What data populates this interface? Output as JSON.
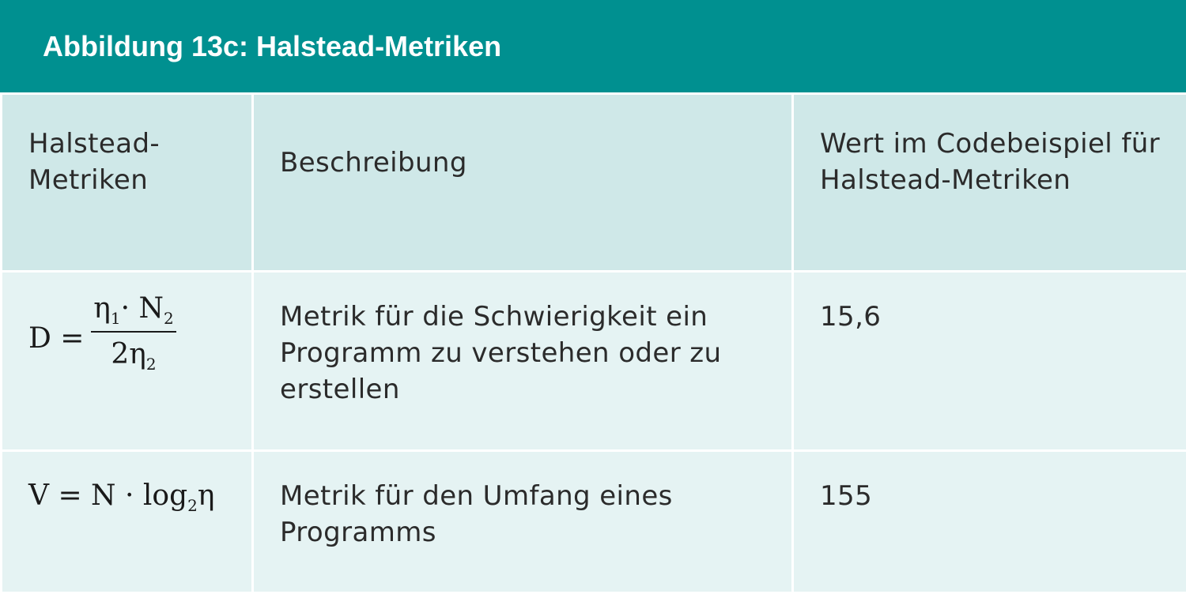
{
  "title": "Abbildung 13c: Halstead-Metriken",
  "colors": {
    "title_bar": "#009090",
    "header_row": "#cfe8e8",
    "body_row": "#e5f3f3"
  },
  "table": {
    "headers": [
      "Halstead-Metriken",
      "Beschreibung",
      "Wert im Codebeispiel für Halstead-Metriken"
    ],
    "rows": [
      {
        "formula": {
          "lhs": "D =",
          "numerator": "η",
          "numerator_sub": "1",
          "numerator_mid": "· N",
          "numerator_sub2": "2",
          "denominator": "2η",
          "denominator_sub": "2"
        },
        "description": "Metrik für die Schwierigkeit ein Programm zu verstehen oder zu erstellen",
        "value": "15,6"
      },
      {
        "formula": {
          "main": "V = N · log",
          "sub": "2",
          "tail": "η"
        },
        "description": "Metrik für den Umfang eines Programms",
        "value": "155"
      }
    ]
  }
}
